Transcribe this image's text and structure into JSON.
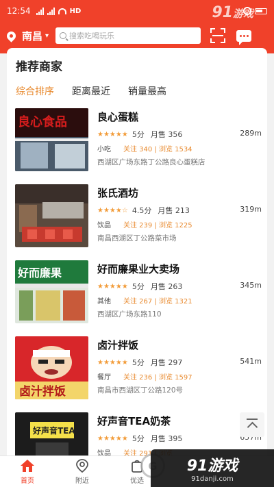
{
  "status_bar": {
    "time": "12:54",
    "network": "HD"
  },
  "header": {
    "location": "南昌",
    "search_placeholder": "搜索吃喝玩乐",
    "icons": [
      "location-pin-icon",
      "scan-icon",
      "message-icon"
    ]
  },
  "section": {
    "title": "推荐商家",
    "sort_tabs": [
      "综合排序",
      "距离最近",
      "销量最高"
    ],
    "active_sort": "综合排序"
  },
  "shops": [
    {
      "name": "良心蛋糕",
      "stars": "★★★★★",
      "rating": "5分",
      "sales": "月售 356",
      "distance": "289m",
      "category": "小吃",
      "stats": "关注 340 | 浏览 1534",
      "address": "西湖区广场东路丁公路良心蛋糕店"
    },
    {
      "name": "张氏酒坊",
      "stars": "★★★★☆",
      "rating": "4.5分",
      "sales": "月售 213",
      "distance": "319m",
      "category": "饮品",
      "stats": "关注 239 | 浏览 1225",
      "address": "南昌西湖区丁公路菜市场"
    },
    {
      "name": "好而廉果业大卖场",
      "stars": "★★★★★",
      "rating": "5分",
      "sales": "月售 263",
      "distance": "345m",
      "category": "其他",
      "stats": "关注 267 | 浏览 1321",
      "address": "西湖区广场东路110"
    },
    {
      "name": "卤汁拌饭",
      "stars": "★★★★★",
      "rating": "5分",
      "sales": "月售 297",
      "distance": "541m",
      "category": "餐厅",
      "stats": "关注 236 | 浏览 1597",
      "address": "南昌市西湖区丁公路120号"
    },
    {
      "name": "好声音TEA奶茶",
      "stars": "★★★★★",
      "rating": "5分",
      "sales": "月售 395",
      "distance": "657m",
      "category": "饮品",
      "stats": "关注 291 | 浏览 ",
      "address": ""
    }
  ],
  "tabbar": [
    {
      "label": "首页",
      "icon": "home-icon",
      "active": true
    },
    {
      "label": "附近",
      "icon": "location-pin-icon",
      "active": false
    },
    {
      "label": "优选",
      "icon": "bag-icon",
      "active": false
    }
  ],
  "watermark": {
    "logo": "91游戏",
    "site": "91danji.com",
    "top_logo": "91游戏",
    "circle": "G"
  },
  "colors": {
    "brand_red": "#f0412a",
    "accent_orange": "#e8892d",
    "star": "#f29b38"
  }
}
